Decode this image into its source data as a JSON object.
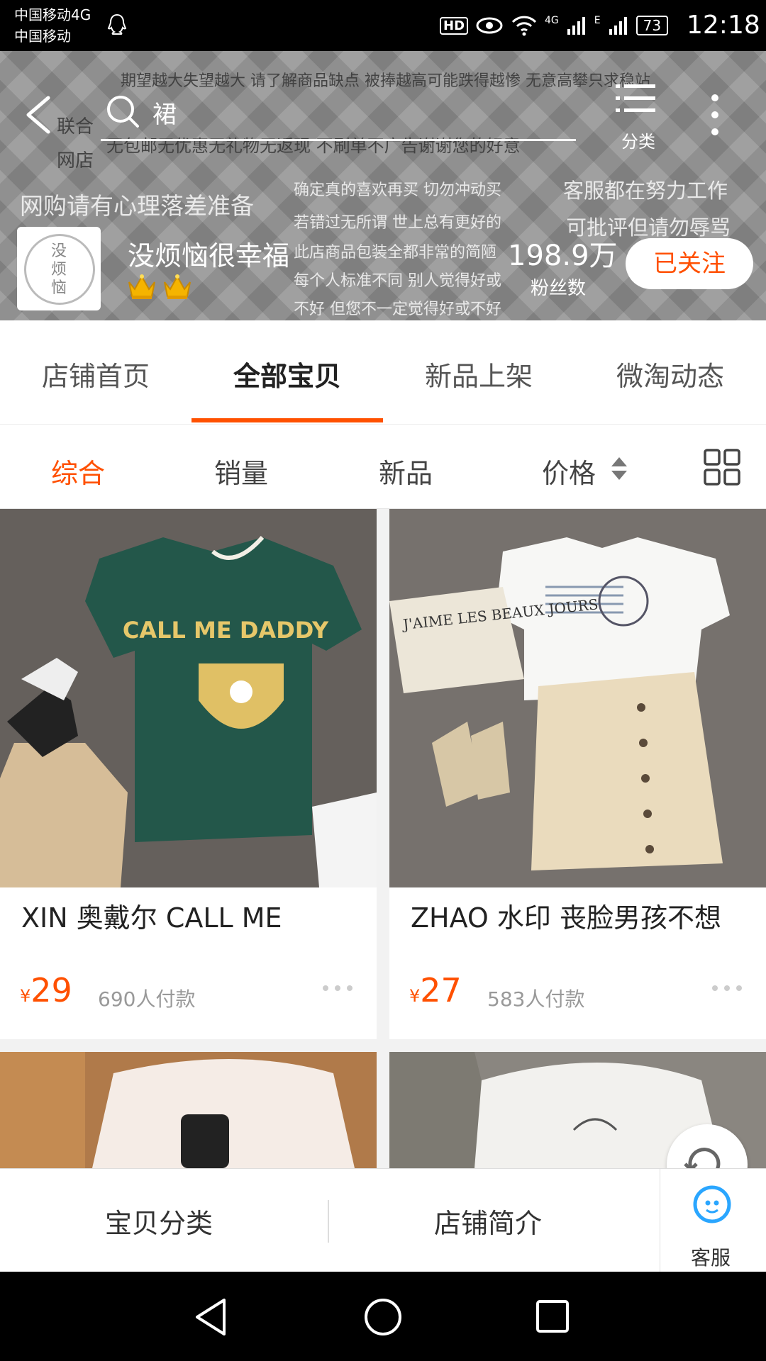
{
  "status_bar": {
    "carrier1": "中国移动4G",
    "carrier2": "中国移动",
    "hd": "HD",
    "net_4g": "4G",
    "net_e": "E",
    "battery": "73",
    "time": "12:18"
  },
  "header": {
    "search_query": "裙",
    "category_label": "分类",
    "banner_texts": [
      "期望越大失望越大 请了解商品缺点 被捧越高可能跌得越惨 无意高攀只求稳站",
      "联合",
      "无包邮无优惠无礼物无返现 不刷单不广告谢谢您的好意",
      "网店",
      "网购请有心理落差准备",
      "确定真的喜欢再买 切勿冲动买",
      "客服都在努力工作",
      "若错过无所谓 世上总有更好的",
      "可批评但请勿辱骂",
      "此店商品包装全都非常的简陋",
      "每个人标准不同 别人觉得好或",
      "不好 但您不一定觉得好或不好"
    ],
    "shop_logo_text": [
      "没",
      "烦",
      "恼"
    ],
    "shop_name": "没烦恼很幸福",
    "crown_icon": "crown-icon",
    "crown_count": 2,
    "fans_count": "198.9万",
    "fans_label": "粉丝数",
    "follow_label": "已关注"
  },
  "tabs": [
    {
      "label": "店铺首页",
      "active": false
    },
    {
      "label": "全部宝贝",
      "active": true
    },
    {
      "label": "新品上架",
      "active": false
    },
    {
      "label": "微淘动态",
      "active": false
    }
  ],
  "sort": {
    "items": [
      "综合",
      "销量",
      "新品",
      "价格"
    ],
    "active": "综合",
    "accent": "#ff5000"
  },
  "products": [
    {
      "title": "XIN 奥戴尔 CALL ME",
      "currency": "¥",
      "price": "29",
      "paid": "690人付款",
      "print_text": "CALL ME DADDY"
    },
    {
      "title": "ZHAO 水印 丧脸男孩不想",
      "currency": "¥",
      "price": "27",
      "paid": "583人付款",
      "print_text": "J'AIME LES BEAUX JOURS"
    }
  ],
  "bottom_bar": {
    "category": "宝贝分类",
    "intro": "店铺简介",
    "service": "客服"
  },
  "colors": {
    "accent": "#ff5000",
    "service_blue": "#2aa6ff"
  }
}
